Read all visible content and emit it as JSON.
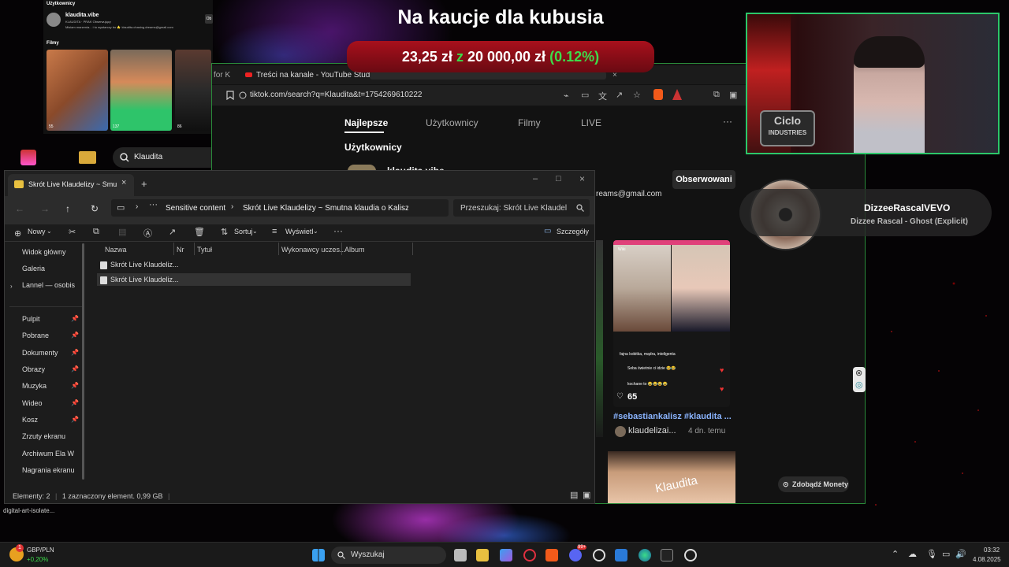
{
  "banner": {
    "title": "Na kaucje dla kubusia",
    "amount": "23,25 zł",
    "sep": "z",
    "goal": "20 000,00 zł",
    "percent": "(0.12%)",
    "percent_color": "#3ddc4a"
  },
  "tiktok_left": {
    "section_users": "Użytkownicy",
    "user_name": "klaudita.vibe",
    "user_sub": "KLAUDITA · PRAK Obserwujący",
    "user_bio": "Misiam marzenia... i to wystarczy bo ⭐ klaudita.chasing.dreams@gmail.com",
    "section_videos": "Filmy",
    "thumbs": [
      {
        "likes": "55"
      },
      {
        "likes": "137"
      },
      {
        "likes": "86"
      }
    ],
    "search_value": "Klaudita"
  },
  "browser": {
    "tabs": [
      {
        "label": "for K"
      },
      {
        "label": "Treści na kanale - YouTube Studio"
      }
    ],
    "url": "tiktok.com/search?q=Klaudita&t=1754269610222",
    "nav_tabs": [
      "Najlepsze",
      "Użytkownicy",
      "Filmy",
      "LIVE"
    ],
    "more": "···",
    "section_title": "Użytkownicy",
    "user_name": "klaudita.vibe",
    "follow_button": "Obserwowani",
    "email_fragment": "reams@gmail.com",
    "video": {
      "hashtags": "#sebastiankalisz #klaudita ...",
      "author": "klaudelizai...",
      "time": "4 dn. temu",
      "likes": "65",
      "comment_1": "fajna kobitka, mądra, inteligenta",
      "comment_2": "Seba świetnie ci idzie 😂😂",
      "comment_3": "kochane to 😂😂😂😂",
      "live_badge": "Wiki"
    },
    "thumb_text": "Klaudita",
    "coin_button": "Zdobądź Monety"
  },
  "webcam": {
    "logo_line1": "Ciclo",
    "logo_line2": "INDUSTRIES"
  },
  "music": {
    "artist": "DizzeeRascalVEVO",
    "track": "Dizzee Rascal - Ghost (Explicit)"
  },
  "explorer": {
    "tab_title": "Skrót Live Klaudelizy ~ Smutna",
    "breadcrumb": [
      "Sensitive content",
      "Skrót Live Klaudelizy ~ Smutna klaudia o Kaliszu i"
    ],
    "search_placeholder": "Przeszukaj: Skrót Live Klaudelizy",
    "commands": {
      "new": "Nowy",
      "sort": "Sortuj",
      "view": "Wyświetl",
      "more": "···",
      "details": "Szczegóły"
    },
    "sidebar": [
      {
        "label": "Widok główny",
        "color": "#e8a33a",
        "pinned": false
      },
      {
        "label": "Galeria",
        "color": "#4aa3e8",
        "pinned": false
      },
      {
        "label": "Lannel — osobis",
        "color": "#3b8de0",
        "pinned": false
      },
      {
        "label": "Pulpit",
        "color": "#3aa0e8",
        "pinned": true
      },
      {
        "label": "Pobrane",
        "color": "#2fb86a",
        "pinned": true
      },
      {
        "label": "Dokumenty",
        "color": "#8aa0c8",
        "pinned": true
      },
      {
        "label": "Obrazy",
        "color": "#4a90e0",
        "pinned": true
      },
      {
        "label": "Muzyka",
        "color": "#e05050",
        "pinned": true
      },
      {
        "label": "Wideo",
        "color": "#9a5ae0",
        "pinned": true
      },
      {
        "label": "Kosz",
        "color": "#aaaaaa",
        "pinned": true
      },
      {
        "label": "Zrzuty ekranu",
        "color": "#e8c040",
        "pinned": false
      },
      {
        "label": "Archiwum Ela W",
        "color": "#e8c040",
        "pinned": false
      },
      {
        "label": "Nagrania ekranu",
        "color": "#e8c040",
        "pinned": false
      }
    ],
    "columns": [
      "Nazwa",
      "Nr",
      "Tytuł",
      "Wykonawcy uczes...",
      "Album"
    ],
    "files": [
      {
        "name": "Skrót Live Klaudeliz...",
        "selected": false
      },
      {
        "name": "Skrót Live Klaudeliz...",
        "selected": true
      }
    ],
    "status_count": "Elementy: 2",
    "status_selected": "1 zaznaczony element. 0,99 GB"
  },
  "desktop": {
    "hover_label": "digital-art-isolate..."
  },
  "taskbar": {
    "ticker_name": "GBP/PLN",
    "ticker_change": "+0,20%",
    "ticker_badge": "1",
    "search_placeholder": "Wyszukaj",
    "time": "03:32",
    "date": "4.08.2025",
    "discord_badge": "99+"
  }
}
